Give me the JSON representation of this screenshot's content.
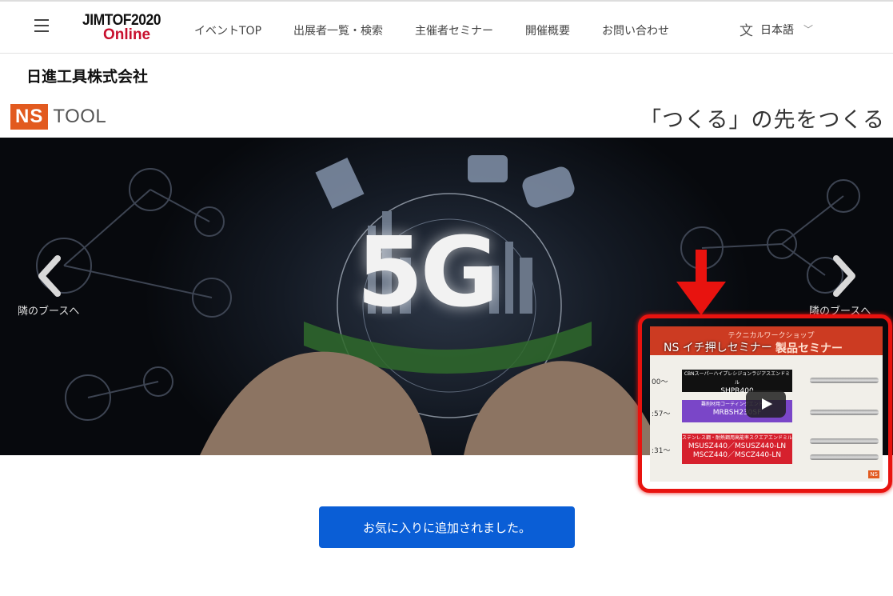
{
  "header": {
    "logo_line1": "JIMTOF2020",
    "logo_line2": "Online",
    "nav": [
      "イベントTOP",
      "出展者一覧・検索",
      "主催者セミナー",
      "開催概要",
      "お問い合わせ"
    ],
    "language": "日本語",
    "language_icon": "translate-icon"
  },
  "company": {
    "name": "日進工具株式会社"
  },
  "brand": {
    "logo_box": "NS",
    "logo_text": "TOOL",
    "tagline": "「つくる」の先をつくる",
    "logo_color": "#e25a1f"
  },
  "hero": {
    "headline": "5G",
    "prev_label": "隣のブースへ",
    "next_label": "隣のブースへ"
  },
  "video": {
    "title": "NS イチ押しセミナー",
    "header_sub": "テクニカルワークショップ",
    "header_main": "製品セミナー",
    "rows": [
      {
        "time": "00～",
        "lines": [
          "CBNスーパーハイプレシジョンラジアスエンドミル",
          "SHPR400"
        ]
      },
      {
        "time": ":57～",
        "lines": [
          "難削材用コーティングエンドミル",
          "MRBSH230SF"
        ]
      },
      {
        "time": ":31～",
        "lines": [
          "ステンレス鋼・耐熱鋼用高能率スクエアエンドミル",
          "MSUSZ440／MSUSZ440-LN",
          "MSCZ440／MSCZ440-LN"
        ]
      }
    ],
    "corner": "NS",
    "highlight_color": "#e8130f"
  },
  "actions": {
    "favorite_label": "お気に入りに追加されました。"
  }
}
